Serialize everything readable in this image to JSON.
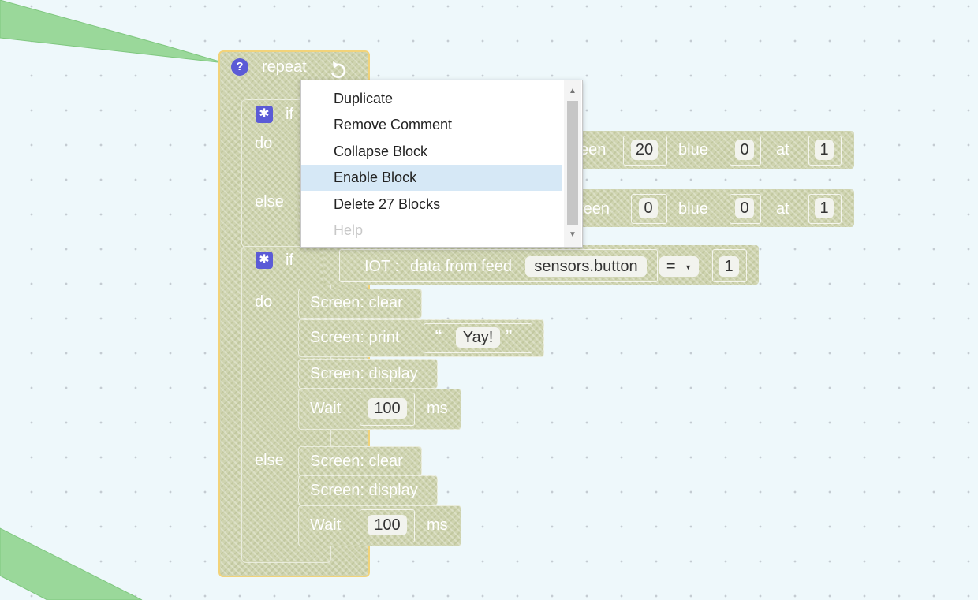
{
  "repeat_block": {
    "label": "repeat",
    "help_icon": "question-icon",
    "loop_icon": "loop-arrow-icon"
  },
  "if_block_1": {
    "if_label": "if",
    "do_label": "do",
    "else_label": "else",
    "do_row": {
      "green_label": "een",
      "green_value": "20",
      "blue_label": "blue",
      "blue_value": "0",
      "at_label": "at",
      "at_value": "1"
    },
    "else_row": {
      "green_label": "reen",
      "green_value": "0",
      "blue_label": "blue",
      "blue_value": "0",
      "at_label": "at",
      "at_value": "1"
    }
  },
  "if_block_2": {
    "if_label": "if",
    "do_label": "do",
    "else_label": "else",
    "condition": {
      "iot_label": "IOT :",
      "data_label": "data from feed",
      "feed": "sensors.button",
      "operator": "=",
      "value": "1"
    },
    "do_statements": {
      "clear": "Screen: clear",
      "print": "Screen: print",
      "print_text": "Yay!",
      "display": "Screen: display",
      "wait": "Wait",
      "wait_value": "100",
      "wait_unit": "ms"
    },
    "else_statements": {
      "clear": "Screen: clear",
      "display": "Screen: display",
      "wait": "Wait",
      "wait_value": "100",
      "wait_unit": "ms"
    }
  },
  "context_menu": {
    "items": [
      {
        "label": "Duplicate"
      },
      {
        "label": "Remove Comment"
      },
      {
        "label": "Collapse Block"
      },
      {
        "label": "Enable Block"
      },
      {
        "label": "Delete 27 Blocks"
      },
      {
        "label": "Help"
      }
    ]
  },
  "colors": {
    "canvas": "#eef8fb",
    "comment_bubble": "#9ad89a",
    "block_outline": "#f2d37a",
    "menu_highlight": "#d6e8f6",
    "icon_purple": "#5b5bd6"
  }
}
